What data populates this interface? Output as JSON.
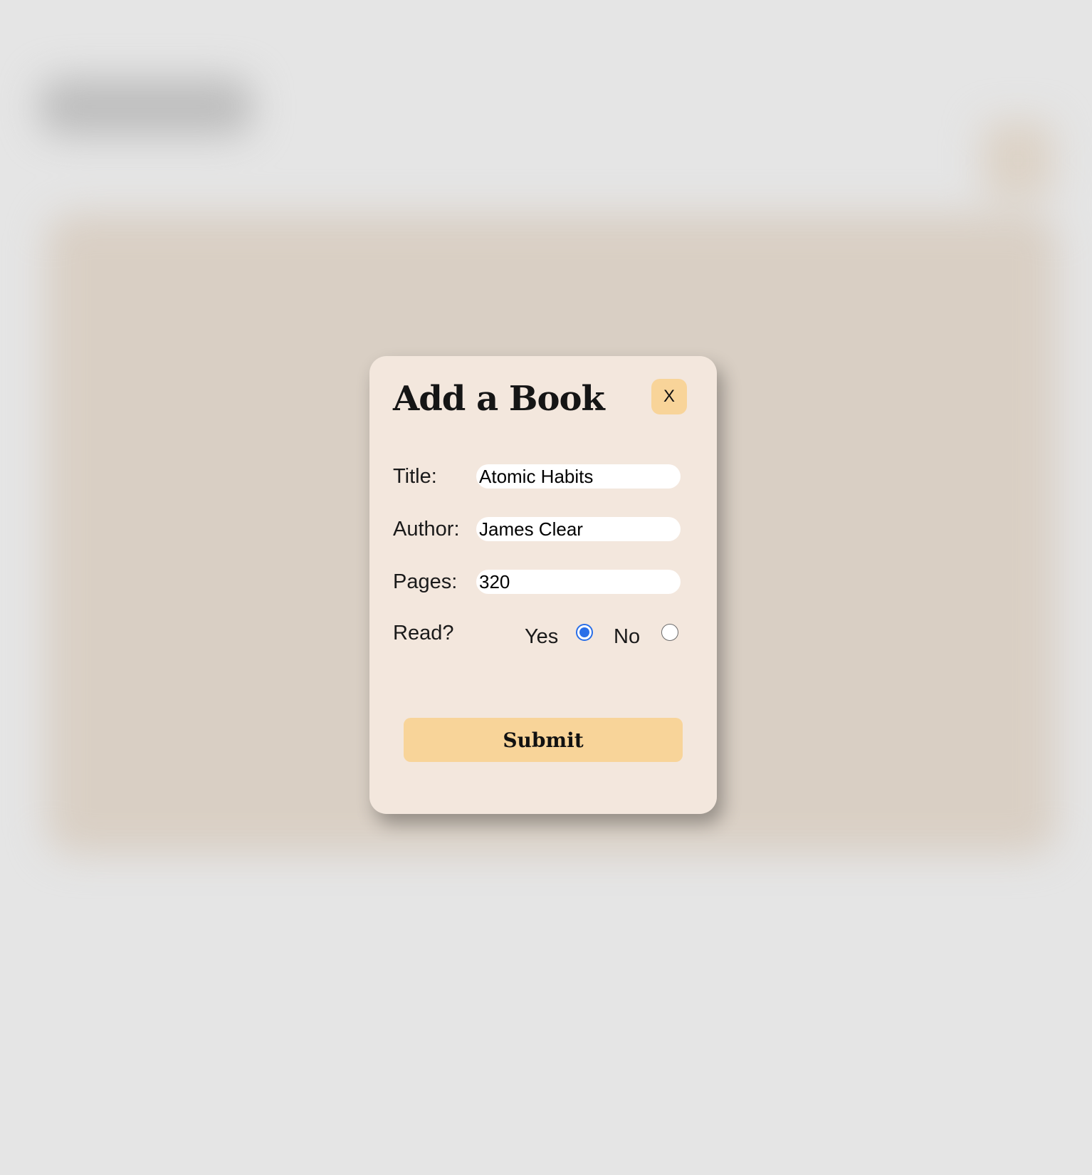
{
  "modal": {
    "title": "Add a Book",
    "close_label": "X",
    "fields": {
      "title": {
        "label": "Title:",
        "value": "Atomic Habits"
      },
      "author": {
        "label": "Author:",
        "value": "James Clear"
      },
      "pages": {
        "label": "Pages:",
        "value": "320"
      }
    },
    "read": {
      "label": "Read?",
      "options": [
        {
          "label": "Yes",
          "selected": true
        },
        {
          "label": "No",
          "selected": false
        }
      ]
    },
    "submit_label": "Submit"
  },
  "colors": {
    "modal_background": "#f3e7dd",
    "accent_button": "#f8d499",
    "radio_selected": "#2a6fe8",
    "page_background": "#e5e5e5"
  }
}
